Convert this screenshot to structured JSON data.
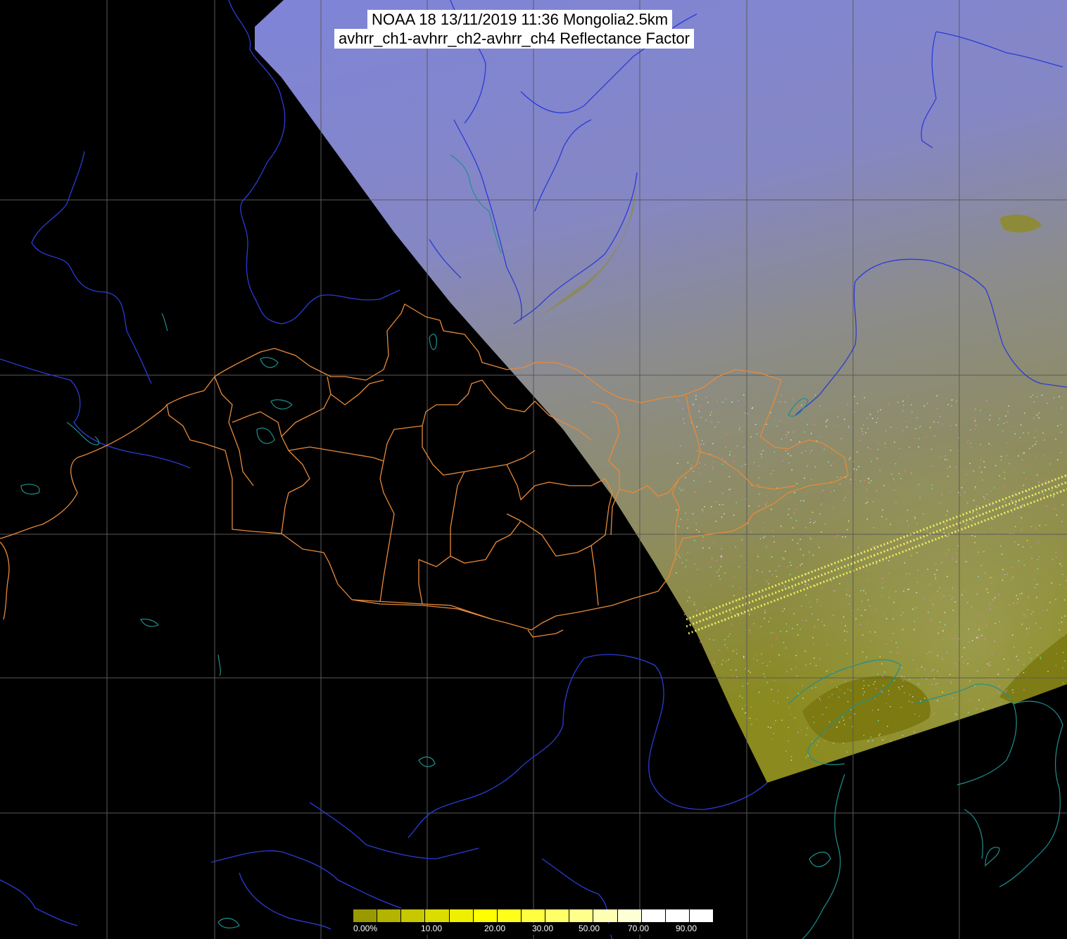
{
  "title": {
    "line1": "NOAA 18 13/11/2019 11:36 Mongolia2.5km",
    "line2": "avhrr_ch1-avhrr_ch2-avhrr_ch4 Reflectance Factor"
  },
  "legend": {
    "labels": [
      "0.00%",
      "10.00",
      "20.00",
      "30.00",
      "50.00",
      "70.00",
      "90.00"
    ],
    "colors": [
      "#9a9a00",
      "#b3b300",
      "#c8c800",
      "#dcdc00",
      "#efef00",
      "#ffff00",
      "#ffff1a",
      "#ffff40",
      "#ffff66",
      "#ffff8c",
      "#ffffb3",
      "#ffffd6",
      "#ffffff",
      "#ffffff",
      "#ffffff"
    ]
  },
  "colors": {
    "background": "#000000",
    "grid": "#5a5a5a",
    "swath_north": "#7f84d8",
    "swath_mid": "#8c8c8c",
    "swath_south": "#8a8a1e",
    "rivers": "#2b3bd6",
    "coast": "#1f8f8f",
    "mongolia_borders": "#e88a3a",
    "noise_stripe": "#ffff60"
  }
}
